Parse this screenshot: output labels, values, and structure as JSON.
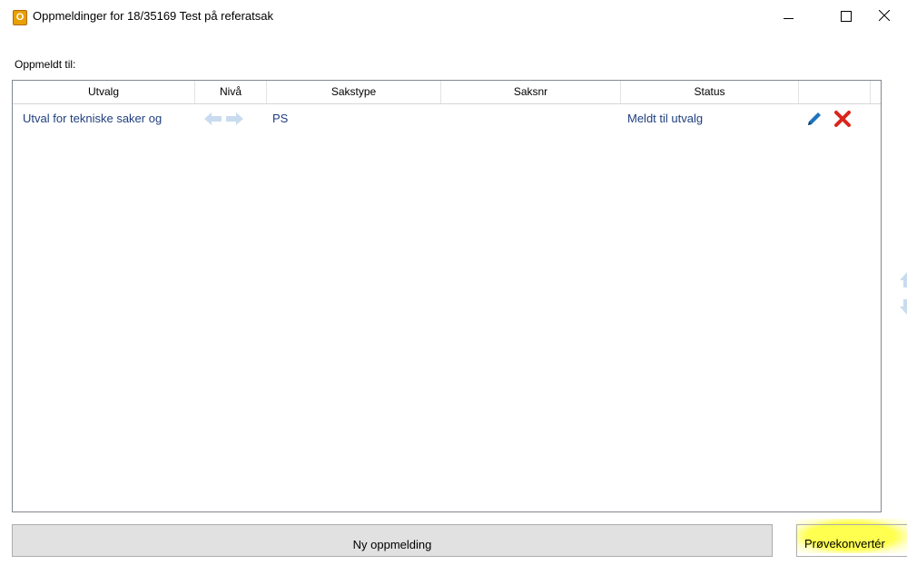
{
  "window": {
    "icon_letter": "O",
    "title": "Oppmeldinger for 18/35169 Test på referatsak"
  },
  "section_label": "Oppmeldt til:",
  "table": {
    "headers": [
      "Utvalg",
      "Nivå",
      "Sakstype",
      "Saksnr",
      "Status",
      ""
    ],
    "rows": [
      {
        "utvalg": "Utval for tekniske saker og",
        "niva_icons": [
          "arrow-left-icon",
          "arrow-right-icon"
        ],
        "sakstype": "PS",
        "saksnr": "",
        "status": "Meldt til utvalg",
        "actions": [
          "edit-icon",
          "delete-icon"
        ]
      }
    ]
  },
  "buttons": {
    "new_label": "Ny oppmelding",
    "convert_label": "Prøvekonvertér"
  },
  "colors": {
    "link_text": "#1f3f7f",
    "delete": "#d9261c",
    "edit": "#1e73be",
    "highlight": "#ffff46"
  }
}
